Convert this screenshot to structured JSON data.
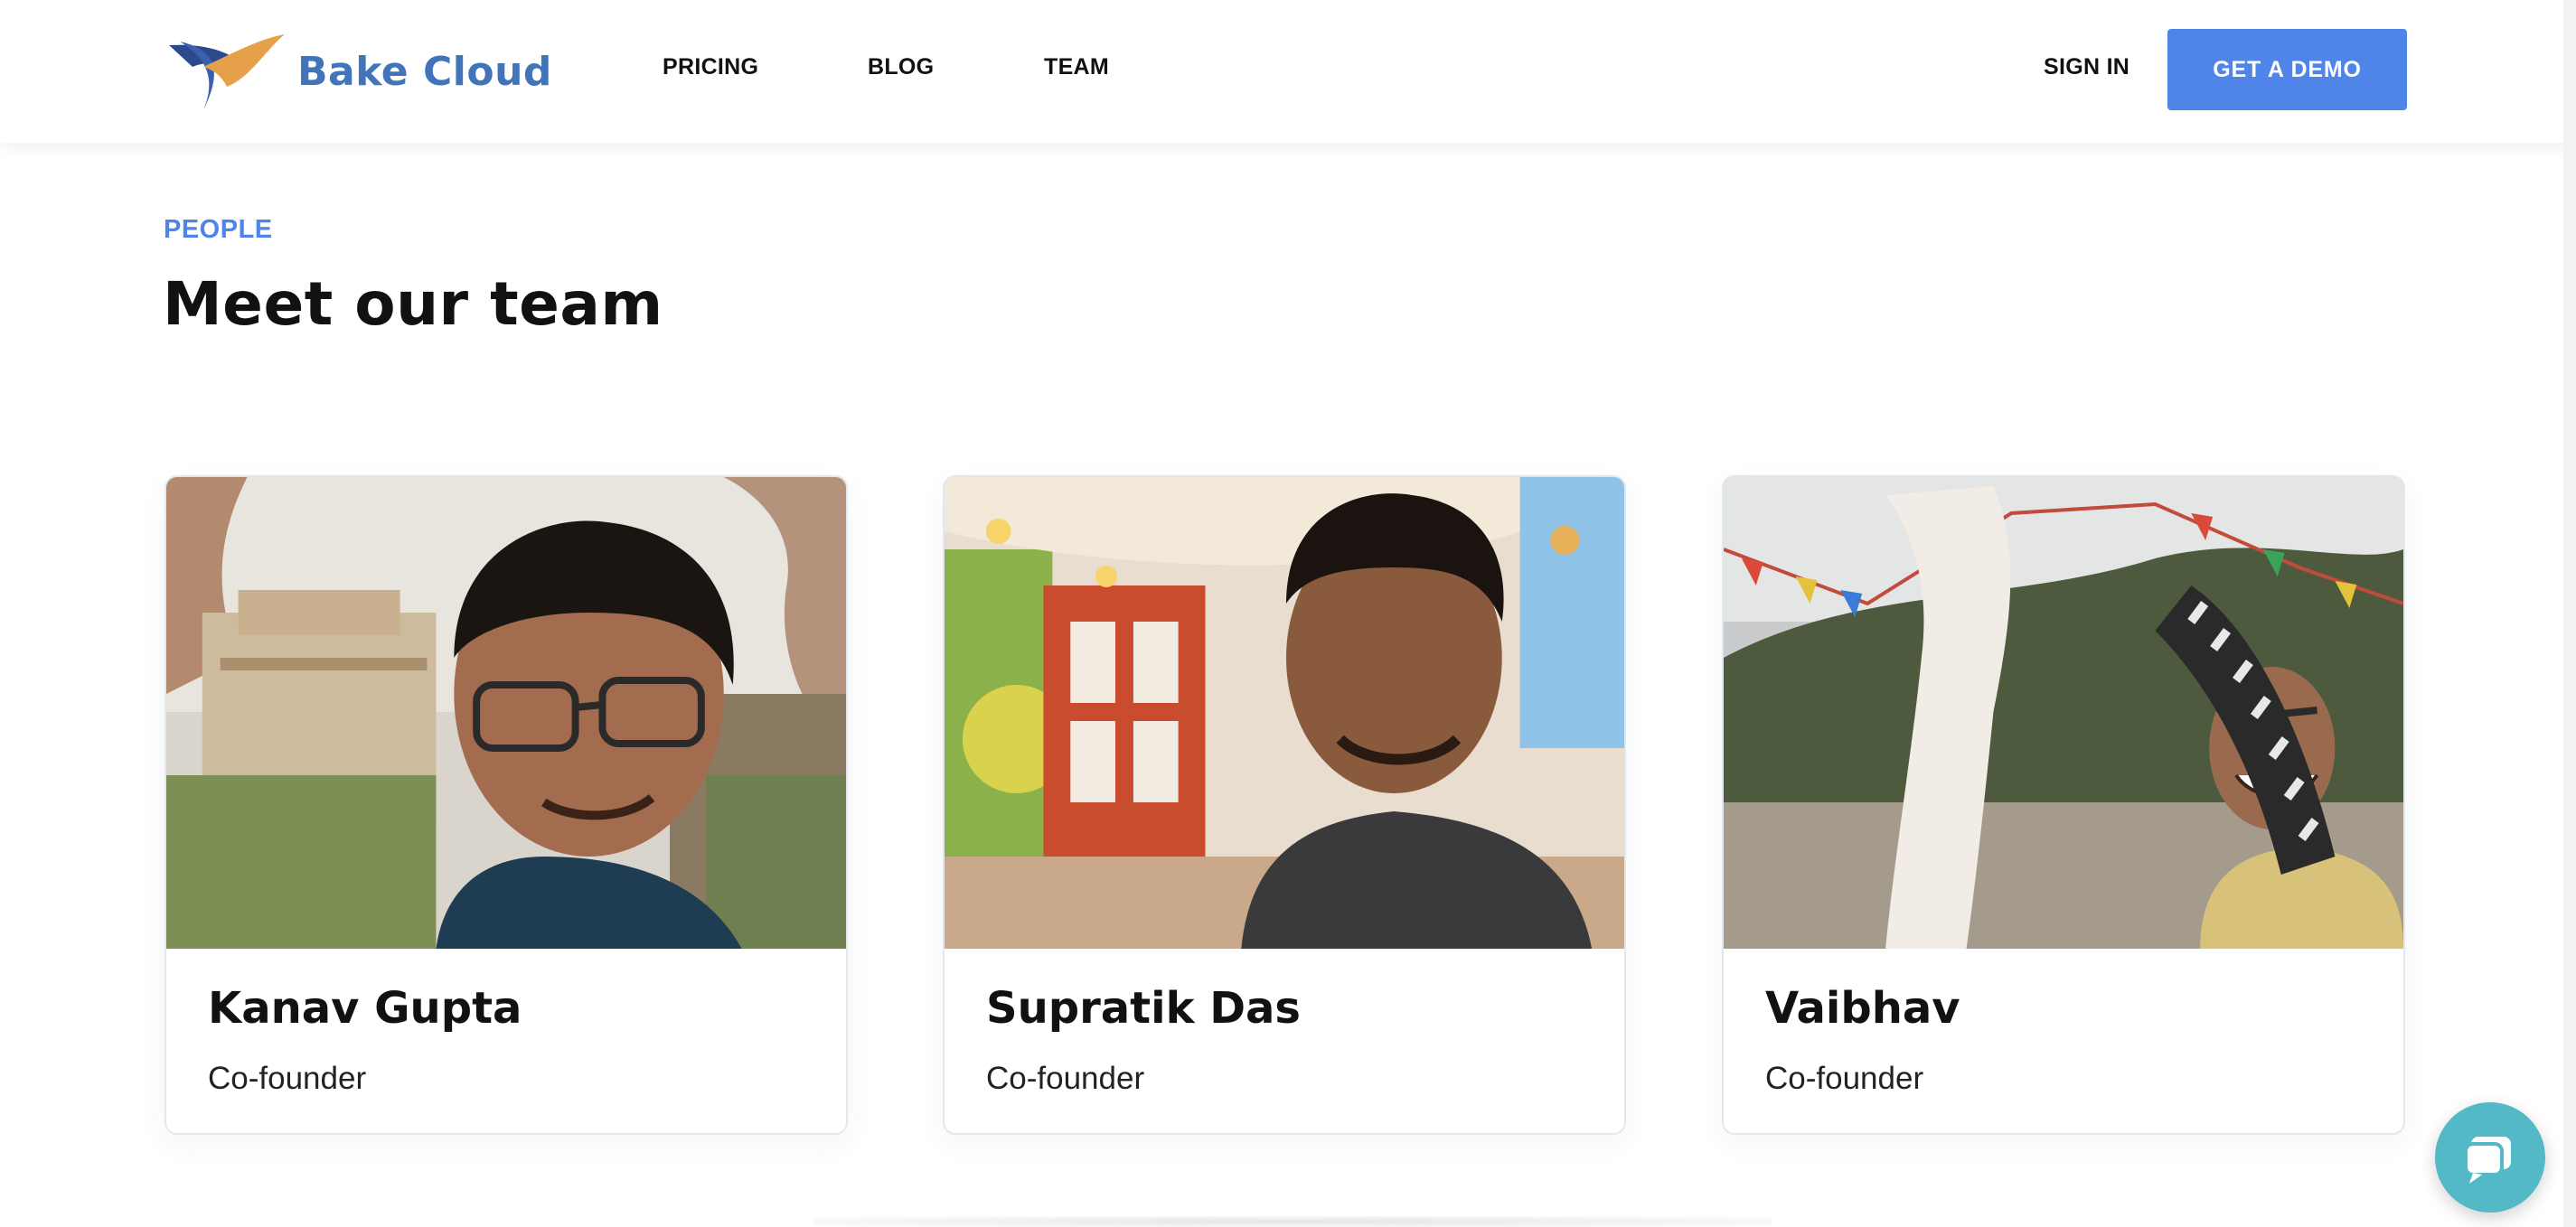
{
  "brand": {
    "name": "Bake Cloud",
    "color": "#4174b8",
    "logo_icon": "swoosh-logo"
  },
  "nav": {
    "links": [
      {
        "label": "PRICING"
      },
      {
        "label": "BLOG"
      },
      {
        "label": "TEAM"
      }
    ],
    "sign_in": "SIGN IN",
    "demo_button": "GET A DEMO",
    "accent_color": "#4f84e8"
  },
  "intro": {
    "eyebrow": "PEOPLE",
    "title": "Meet our team"
  },
  "team": [
    {
      "name": "Kanav Gupta",
      "role": "Co-founder"
    },
    {
      "name": "Supratik Das",
      "role": "Co-founder"
    },
    {
      "name": "Vaibhav",
      "role": "Co-founder"
    }
  ],
  "chat_widget": {
    "icon": "chat-bubble-icon",
    "color": "#53b9c7"
  }
}
